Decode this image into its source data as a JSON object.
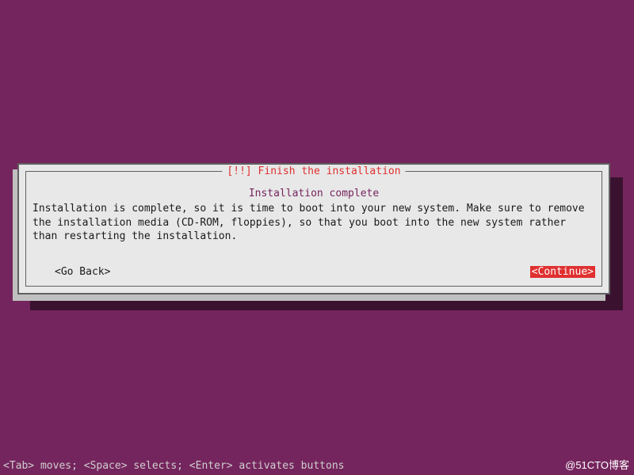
{
  "dialog": {
    "title": "[!!] Finish the installation",
    "subtitle": "Installation complete",
    "body": "Installation is complete, so it is time to boot into your new system. Make sure to remove the installation media (CD-ROM, floppies), so that you boot into the new system rather than restarting the installation.",
    "go_back_label": "<Go Back>",
    "continue_label": "<Continue>"
  },
  "status_bar": "<Tab> moves; <Space> selects; <Enter> activates buttons",
  "watermark": "@51CTO博客"
}
